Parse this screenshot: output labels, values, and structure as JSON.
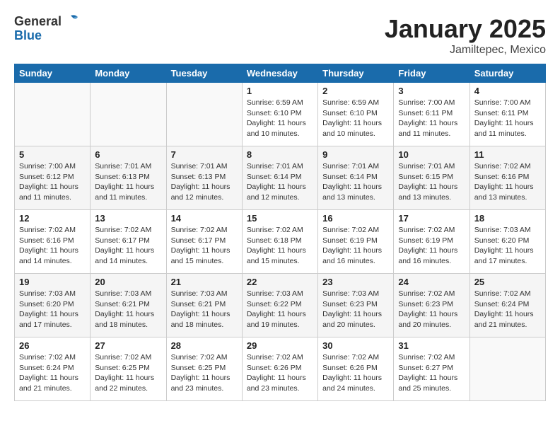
{
  "header": {
    "logo_general": "General",
    "logo_blue": "Blue",
    "month_title": "January 2025",
    "location": "Jamiltepec, Mexico"
  },
  "days_of_week": [
    "Sunday",
    "Monday",
    "Tuesday",
    "Wednesday",
    "Thursday",
    "Friday",
    "Saturday"
  ],
  "weeks": [
    [
      {
        "num": "",
        "info": ""
      },
      {
        "num": "",
        "info": ""
      },
      {
        "num": "",
        "info": ""
      },
      {
        "num": "1",
        "info": "Sunrise: 6:59 AM\nSunset: 6:10 PM\nDaylight: 11 hours\nand 10 minutes."
      },
      {
        "num": "2",
        "info": "Sunrise: 6:59 AM\nSunset: 6:10 PM\nDaylight: 11 hours\nand 10 minutes."
      },
      {
        "num": "3",
        "info": "Sunrise: 7:00 AM\nSunset: 6:11 PM\nDaylight: 11 hours\nand 11 minutes."
      },
      {
        "num": "4",
        "info": "Sunrise: 7:00 AM\nSunset: 6:11 PM\nDaylight: 11 hours\nand 11 minutes."
      }
    ],
    [
      {
        "num": "5",
        "info": "Sunrise: 7:00 AM\nSunset: 6:12 PM\nDaylight: 11 hours\nand 11 minutes."
      },
      {
        "num": "6",
        "info": "Sunrise: 7:01 AM\nSunset: 6:13 PM\nDaylight: 11 hours\nand 11 minutes."
      },
      {
        "num": "7",
        "info": "Sunrise: 7:01 AM\nSunset: 6:13 PM\nDaylight: 11 hours\nand 12 minutes."
      },
      {
        "num": "8",
        "info": "Sunrise: 7:01 AM\nSunset: 6:14 PM\nDaylight: 11 hours\nand 12 minutes."
      },
      {
        "num": "9",
        "info": "Sunrise: 7:01 AM\nSunset: 6:14 PM\nDaylight: 11 hours\nand 13 minutes."
      },
      {
        "num": "10",
        "info": "Sunrise: 7:01 AM\nSunset: 6:15 PM\nDaylight: 11 hours\nand 13 minutes."
      },
      {
        "num": "11",
        "info": "Sunrise: 7:02 AM\nSunset: 6:16 PM\nDaylight: 11 hours\nand 13 minutes."
      }
    ],
    [
      {
        "num": "12",
        "info": "Sunrise: 7:02 AM\nSunset: 6:16 PM\nDaylight: 11 hours\nand 14 minutes."
      },
      {
        "num": "13",
        "info": "Sunrise: 7:02 AM\nSunset: 6:17 PM\nDaylight: 11 hours\nand 14 minutes."
      },
      {
        "num": "14",
        "info": "Sunrise: 7:02 AM\nSunset: 6:17 PM\nDaylight: 11 hours\nand 15 minutes."
      },
      {
        "num": "15",
        "info": "Sunrise: 7:02 AM\nSunset: 6:18 PM\nDaylight: 11 hours\nand 15 minutes."
      },
      {
        "num": "16",
        "info": "Sunrise: 7:02 AM\nSunset: 6:19 PM\nDaylight: 11 hours\nand 16 minutes."
      },
      {
        "num": "17",
        "info": "Sunrise: 7:02 AM\nSunset: 6:19 PM\nDaylight: 11 hours\nand 16 minutes."
      },
      {
        "num": "18",
        "info": "Sunrise: 7:03 AM\nSunset: 6:20 PM\nDaylight: 11 hours\nand 17 minutes."
      }
    ],
    [
      {
        "num": "19",
        "info": "Sunrise: 7:03 AM\nSunset: 6:20 PM\nDaylight: 11 hours\nand 17 minutes."
      },
      {
        "num": "20",
        "info": "Sunrise: 7:03 AM\nSunset: 6:21 PM\nDaylight: 11 hours\nand 18 minutes."
      },
      {
        "num": "21",
        "info": "Sunrise: 7:03 AM\nSunset: 6:21 PM\nDaylight: 11 hours\nand 18 minutes."
      },
      {
        "num": "22",
        "info": "Sunrise: 7:03 AM\nSunset: 6:22 PM\nDaylight: 11 hours\nand 19 minutes."
      },
      {
        "num": "23",
        "info": "Sunrise: 7:03 AM\nSunset: 6:23 PM\nDaylight: 11 hours\nand 20 minutes."
      },
      {
        "num": "24",
        "info": "Sunrise: 7:02 AM\nSunset: 6:23 PM\nDaylight: 11 hours\nand 20 minutes."
      },
      {
        "num": "25",
        "info": "Sunrise: 7:02 AM\nSunset: 6:24 PM\nDaylight: 11 hours\nand 21 minutes."
      }
    ],
    [
      {
        "num": "26",
        "info": "Sunrise: 7:02 AM\nSunset: 6:24 PM\nDaylight: 11 hours\nand 21 minutes."
      },
      {
        "num": "27",
        "info": "Sunrise: 7:02 AM\nSunset: 6:25 PM\nDaylight: 11 hours\nand 22 minutes."
      },
      {
        "num": "28",
        "info": "Sunrise: 7:02 AM\nSunset: 6:25 PM\nDaylight: 11 hours\nand 23 minutes."
      },
      {
        "num": "29",
        "info": "Sunrise: 7:02 AM\nSunset: 6:26 PM\nDaylight: 11 hours\nand 23 minutes."
      },
      {
        "num": "30",
        "info": "Sunrise: 7:02 AM\nSunset: 6:26 PM\nDaylight: 11 hours\nand 24 minutes."
      },
      {
        "num": "31",
        "info": "Sunrise: 7:02 AM\nSunset: 6:27 PM\nDaylight: 11 hours\nand 25 minutes."
      },
      {
        "num": "",
        "info": ""
      }
    ]
  ]
}
